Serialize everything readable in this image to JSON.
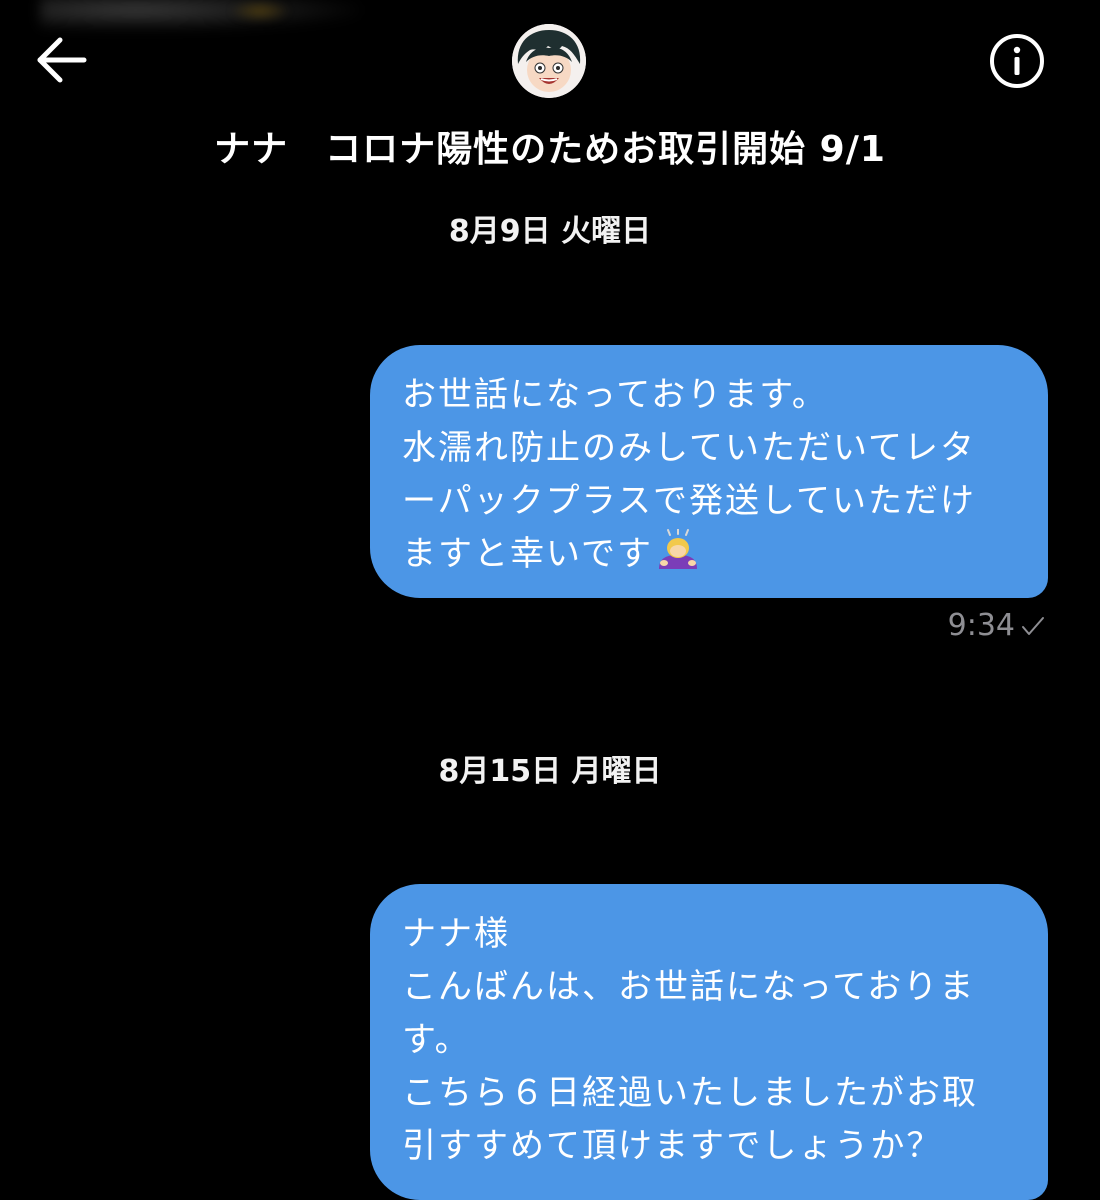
{
  "header": {
    "back_icon": "arrow-left-icon",
    "info_icon": "info-circle-icon",
    "avatar_icon": "cartoon-boy-avatar",
    "title": "ナナ　コロナ陽性のためお取引開始 9/1"
  },
  "messages": [
    {
      "date": "8月9日 火曜日",
      "lines": [
        "お世話になっております。",
        "水濡れ防止のみしていただいてレタ",
        "ーパックプラスで発送していただけ",
        "ますと幸いです"
      ],
      "emoji": "person-bowing-emoji",
      "time": "9:34",
      "status_icon": "checkmark-icon"
    },
    {
      "date": "8月15日 月曜日",
      "lines": [
        "ナナ様",
        "こんばんは、お世話になっておりま",
        "す。",
        "こちら６日経過いたしましたがお取",
        "引すすめて頂けますでしょうか？"
      ]
    }
  ],
  "colors": {
    "background": "#000000",
    "bubble": "#4c96e6",
    "timestamp": "#8e8e93"
  }
}
